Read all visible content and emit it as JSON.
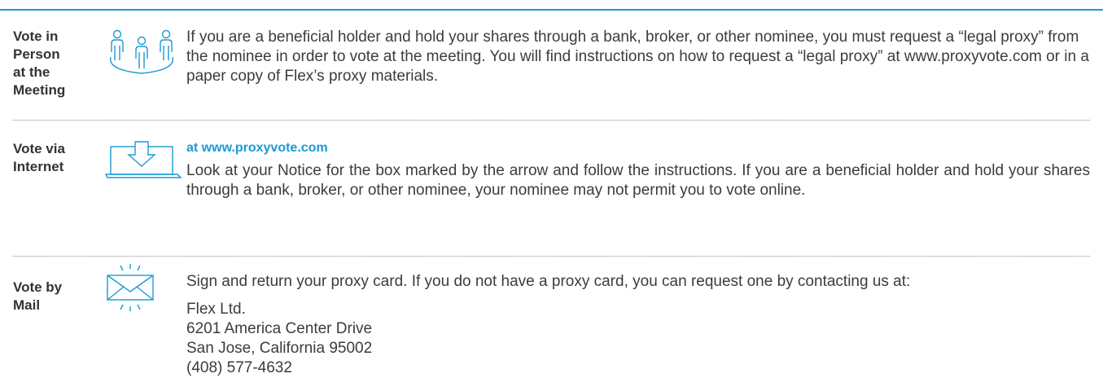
{
  "sections": [
    {
      "label_lines": [
        "Vote in",
        "Person",
        "at the",
        "Meeting"
      ],
      "icon": "people-icon",
      "body": "If you are a beneficial holder and hold your shares through a bank, broker, or other nominee, you must request a “legal proxy” from the nominee in order to vote at the meeting. You will find instructions on how to request a “legal proxy” at www.proxyvote.com or in a paper copy of Flex’s proxy materials."
    },
    {
      "label_lines": [
        "Vote via",
        "Internet"
      ],
      "icon": "laptop-download-icon",
      "link": "at www.proxyvote.com",
      "body": "Look at your Notice for the box marked by the arrow and follow the instructions. If you are a beneficial holder and hold your shares through a bank, broker, or other nominee, your nominee may not permit you to vote online."
    },
    {
      "label_lines": [
        "Vote by",
        "Mail"
      ],
      "icon": "envelope-icon",
      "body": "Sign and return your proxy card. If you do not have a proxy card, you can request one by contacting us at:",
      "address": [
        "Flex Ltd.",
        "6201 America Center Drive",
        "San Jose, California 95002",
        "(408) 577-4632"
      ]
    }
  ],
  "colors": {
    "accent": "#1a9ad6",
    "text": "#3c3c3c"
  }
}
